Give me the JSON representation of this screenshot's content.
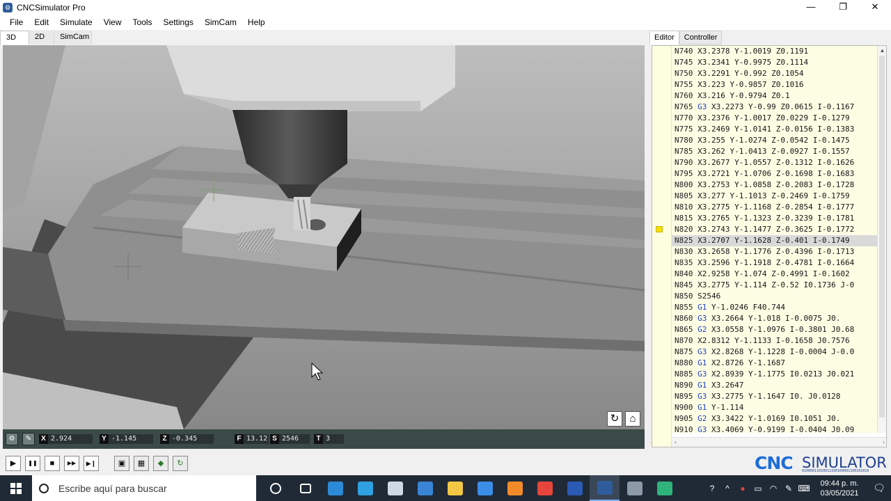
{
  "window": {
    "title": "CNCSimulator Pro",
    "icon": "gear-icon",
    "controls": [
      "—",
      "❐",
      "✕"
    ]
  },
  "menu": [
    "File",
    "Edit",
    "Simulate",
    "View",
    "Tools",
    "Settings",
    "SimCam",
    "Help"
  ],
  "view_tabs": [
    "3D",
    "2D",
    "SimCam"
  ],
  "right_tabs": [
    "Editor",
    "Controller"
  ],
  "viewport": {
    "tools": [
      "reset-view-icon",
      "machine-icon"
    ]
  },
  "readouts": [
    {
      "label": "X",
      "value": "2.924"
    },
    {
      "label": "Y",
      "value": "-1.145"
    },
    {
      "label": "Z",
      "value": "-0.345"
    },
    {
      "label": "F",
      "value": "13.12"
    },
    {
      "label": "S",
      "value": "2546"
    },
    {
      "label": "T",
      "value": "3"
    }
  ],
  "editor": {
    "current_line_index": 17,
    "lines": [
      [
        "N740",
        "",
        "X3.2378 Y-1.0019 Z0.1191"
      ],
      [
        "N745",
        "",
        "X3.2341 Y-0.9975 Z0.1114"
      ],
      [
        "N750",
        "",
        "X3.2291 Y-0.992 Z0.1054"
      ],
      [
        "N755",
        "",
        "X3.223 Y-0.9857 Z0.1016"
      ],
      [
        "N760",
        "",
        "X3.216 Y-0.9794 Z0.1"
      ],
      [
        "N765",
        "G3",
        "X3.2273 Y-0.99 Z0.0615 I-0.1167"
      ],
      [
        "N770",
        "",
        "X3.2376 Y-1.0017 Z0.0229 I-0.1279"
      ],
      [
        "N775",
        "",
        "X3.2469 Y-1.0141 Z-0.0156 I-0.1383"
      ],
      [
        "N780",
        "",
        "X3.255 Y-1.0274 Z-0.0542 I-0.1475"
      ],
      [
        "N785",
        "",
        "X3.262 Y-1.0413 Z-0.0927 I-0.1557"
      ],
      [
        "N790",
        "",
        "X3.2677 Y-1.0557 Z-0.1312 I-0.1626"
      ],
      [
        "N795",
        "",
        "X3.2721 Y-1.0706 Z-0.1698 I-0.1683"
      ],
      [
        "N800",
        "",
        "X3.2753 Y-1.0858 Z-0.2083 I-0.1728"
      ],
      [
        "N805",
        "",
        "X3.277 Y-1.1013 Z-0.2469 I-0.1759"
      ],
      [
        "N810",
        "",
        "X3.2775 Y-1.1168 Z-0.2854 I-0.1777"
      ],
      [
        "N815",
        "",
        "X3.2765 Y-1.1323 Z-0.3239 I-0.1781"
      ],
      [
        "N820",
        "",
        "X3.2743 Y-1.1477 Z-0.3625 I-0.1772"
      ],
      [
        "N825",
        "",
        "X3.2707 Y-1.1628 Z-0.401 I-0.1749"
      ],
      [
        "N830",
        "",
        "X3.2658 Y-1.1776 Z-0.4396 I-0.1713"
      ],
      [
        "N835",
        "",
        "X3.2596 Y-1.1918 Z-0.4781 I-0.1664"
      ],
      [
        "N840",
        "",
        "X2.9258 Y-1.074 Z-0.4991 I-0.1602"
      ],
      [
        "N845",
        "",
        "X3.2775 Y-1.114 Z-0.52 I0.1736 J-0"
      ],
      [
        "N850",
        "",
        "S2546"
      ],
      [
        "N855",
        "G1",
        "Y-1.0246 F40.744"
      ],
      [
        "N860",
        "G3",
        "X3.2664 Y-1.018 I-0.0075 J0."
      ],
      [
        "N865",
        "G2",
        "X3.0558 Y-1.0976 I-0.3801 J0.68"
      ],
      [
        "N870",
        "",
        "X2.8312 Y-1.1133 I-0.1658 J0.7576"
      ],
      [
        "N875",
        "G3",
        "X2.8268 Y-1.1228 I-0.0004 J-0.0"
      ],
      [
        "N880",
        "G1",
        "X2.8726 Y-1.1687"
      ],
      [
        "N885",
        "G3",
        "X2.8939 Y-1.1775 I0.0213 J0.021"
      ],
      [
        "N890",
        "G1",
        "X3.2647"
      ],
      [
        "N895",
        "G3",
        "X3.2775 Y-1.1647 I0. J0.0128"
      ],
      [
        "N900",
        "G1",
        "Y-1.114"
      ],
      [
        "N905",
        "G2",
        "X3.3422 Y-1.0169 I0.1051 J0."
      ],
      [
        "N910",
        "G3",
        "X3.4069 Y-0.9199 I-0.0404 J0.09"
      ]
    ]
  },
  "playbar": {
    "buttons": [
      "play-icon",
      "pause-icon",
      "stop-icon",
      "fast-forward-icon",
      "step-icon"
    ],
    "tools": [
      "window-icon",
      "film-icon",
      "cube-icon",
      "refresh-icon"
    ],
    "glyphs": [
      "▶",
      "❚❚",
      "■",
      "▶▶",
      "▶❙",
      "▣",
      "▦",
      "◆",
      "↻"
    ]
  },
  "brand": {
    "cnc": "CNC",
    "sim": "SIMULATOR",
    "bin": "01000011010011100100001100101010"
  },
  "taskbar": {
    "search_placeholder": "Escribe aquí para buscar",
    "apps": [
      {
        "name": "cortana-icon",
        "color": "#1f2a36"
      },
      {
        "name": "task-view-icon",
        "color": "#1f2a36"
      },
      {
        "name": "visual-studio-code-icon",
        "color": "#2c8bd8"
      },
      {
        "name": "edge-icon",
        "color": "#2fa0e0"
      },
      {
        "name": "dropbox-icon",
        "color": "#cfd8e5"
      },
      {
        "name": "store-icon",
        "color": "#3a84d6"
      },
      {
        "name": "file-explorer-icon",
        "color": "#f2c744"
      },
      {
        "name": "mail-icon",
        "color": "#3a8ee6"
      },
      {
        "name": "foxit-icon",
        "color": "#f18b2a"
      },
      {
        "name": "chrome-icon",
        "color": "#e6453b"
      },
      {
        "name": "word-icon",
        "color": "#2b5ab5"
      },
      {
        "name": "cnc-simulator-taskbar-icon",
        "color": "#2f5c9a"
      },
      {
        "name": "calculator-icon",
        "color": "#8c99a6"
      },
      {
        "name": "terminal-icon",
        "color": "#2fb37a"
      }
    ],
    "tray": [
      "help-icon",
      "chevron-up-icon",
      "record-icon",
      "battery-icon",
      "wifi-icon",
      "pen-icon",
      "keyboard-icon"
    ],
    "tray_glyphs": [
      "?",
      "^",
      "●",
      "▭",
      "◠",
      "✎",
      "⌨"
    ],
    "time": "09:44 p. m.",
    "date": "03/05/2021",
    "notification_glyph": "🗨"
  }
}
